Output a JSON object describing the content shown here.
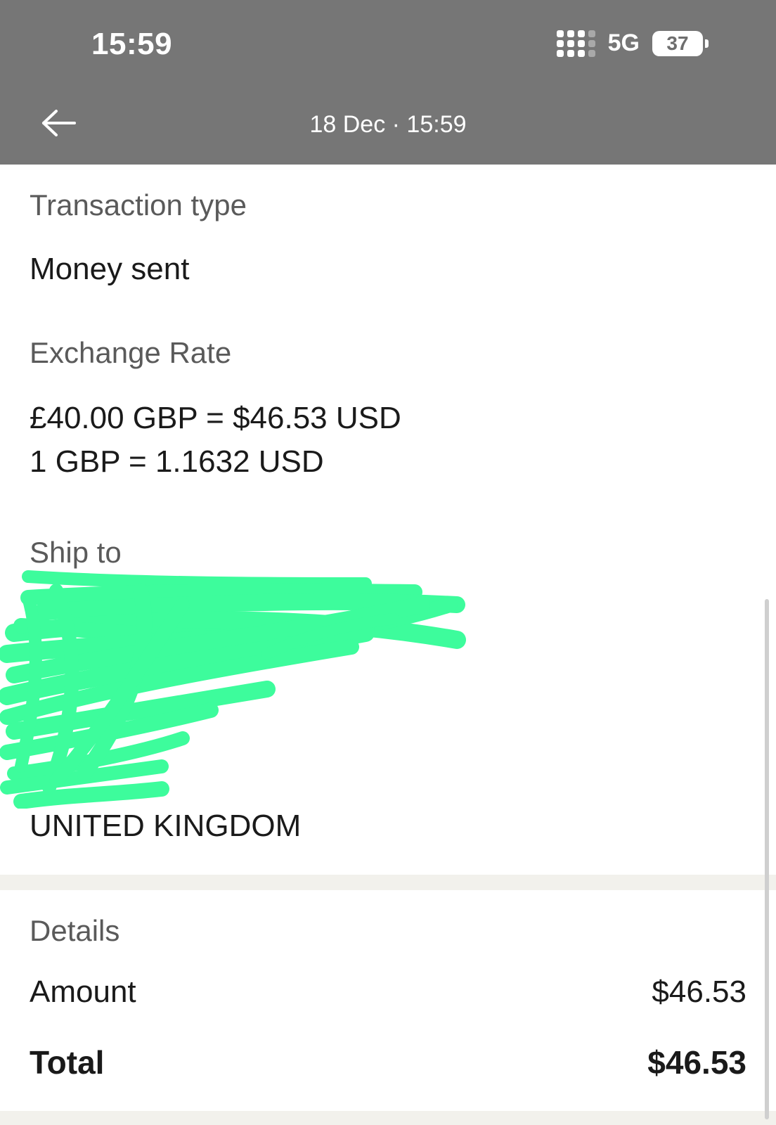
{
  "status_bar": {
    "time": "15:59",
    "network": "5G",
    "battery": "37"
  },
  "nav": {
    "title": "18 Dec · 15:59"
  },
  "transaction_type": {
    "label": "Transaction type",
    "value": "Money sent"
  },
  "exchange_rate": {
    "label": "Exchange Rate",
    "line1": "£40.00 GBP = $46.53 USD",
    "line2": "1 GBP = 1.1632 USD"
  },
  "ship_to": {
    "label": "Ship to",
    "country": "UNITED KINGDOM"
  },
  "details": {
    "label": "Details",
    "amount_label": "Amount",
    "amount_value": "$46.53",
    "total_label": "Total",
    "total_value": "$46.53"
  },
  "colors": {
    "header_bg": "#767676",
    "redaction": "#3dfc9c"
  },
  "icons": [
    "back-arrow-icon",
    "signal-icon",
    "battery-icon"
  ]
}
